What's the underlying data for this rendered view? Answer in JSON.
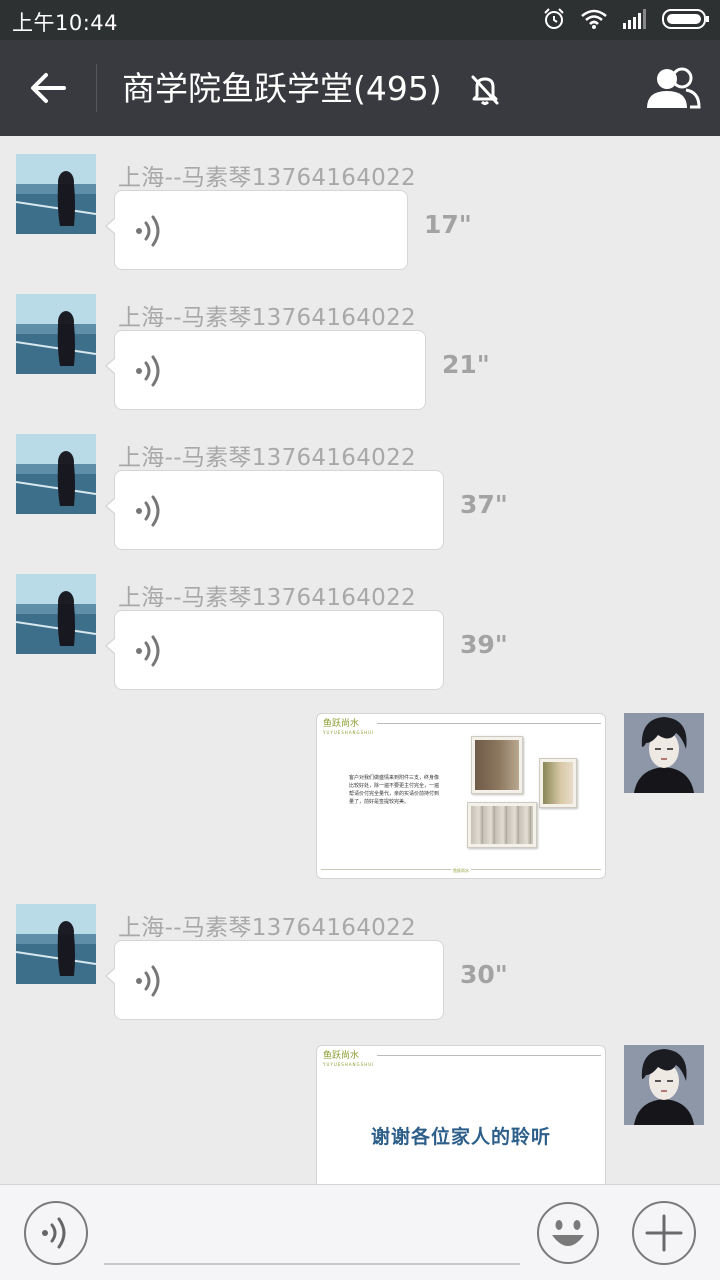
{
  "status_bar": {
    "time": "上午10:44"
  },
  "header": {
    "title": "商学院鱼跃学堂(495)"
  },
  "messages": [
    {
      "sender": "上海--马素琴13764164022",
      "duration": "17\""
    },
    {
      "sender": "上海--马素琴13764164022",
      "duration": "21\""
    },
    {
      "sender": "上海--马素琴13764164022",
      "duration": "37\""
    },
    {
      "sender": "上海--马素琴13764164022",
      "duration": "39\""
    },
    {
      "sender": "上海--马素琴13764164022",
      "duration": "30\""
    }
  ],
  "slides": [
    {
      "brand": "鱼跃尚水",
      "brand_sub": "YUYUESHANGSHUI",
      "text": "客户对我们做盛情来到附件三支，终身像比较好处，除一遍不要更主付完全，一遍帮请价付完全量代，亲的实请价前持付到量了，前好是签提较完美。",
      "footer": "鱼跃尚水"
    },
    {
      "brand": "鱼跃尚水",
      "brand_sub": "YUYUESHANGSHUI",
      "thanks": "谢谢各位家人的聆听"
    }
  ]
}
